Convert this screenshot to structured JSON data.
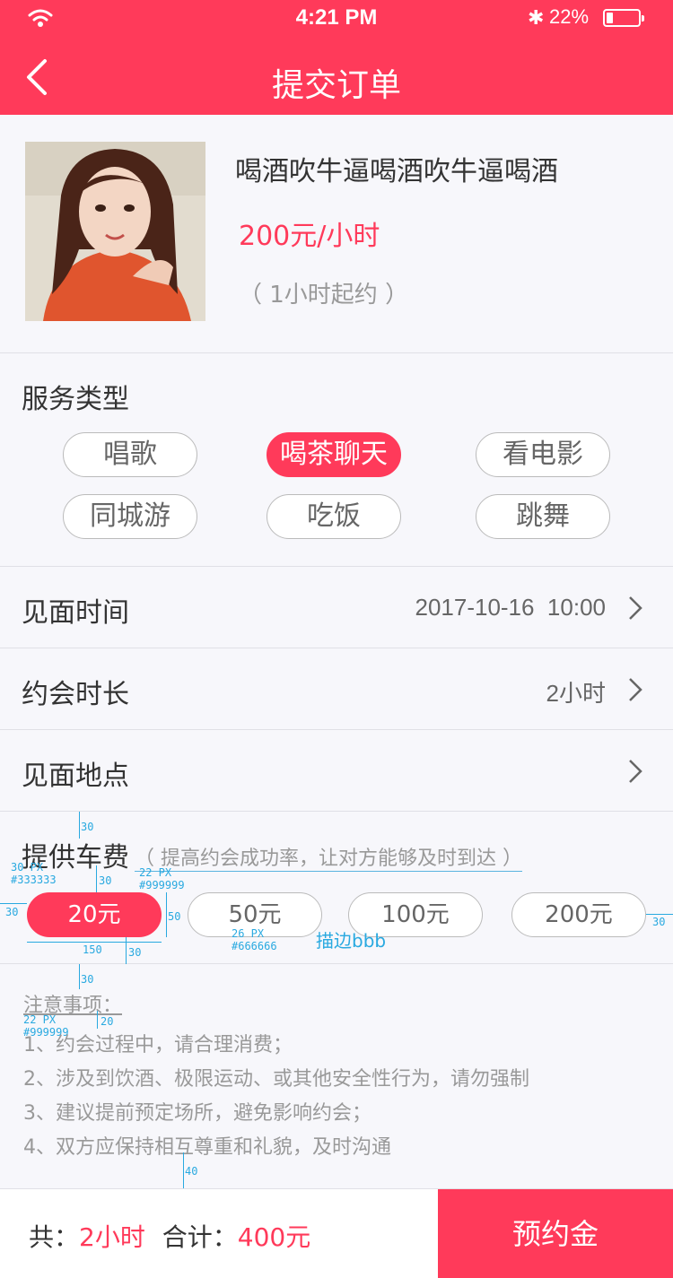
{
  "status_bar": {
    "time": "4:21 PM",
    "battery_percent": "22%",
    "battery_level": 0.22
  },
  "nav": {
    "title": "提交订单"
  },
  "product": {
    "name": "喝酒吹牛逼喝酒吹牛逼喝酒",
    "price": "200元/小时",
    "minimum": "（ 1小时起约 ）"
  },
  "service": {
    "label": "服务类型",
    "options": [
      "唱歌",
      "喝茶聊天",
      "看电影",
      "同城游",
      "吃饭",
      "跳舞"
    ],
    "selected": "喝茶聊天"
  },
  "meeting_time": {
    "label": "见面时间",
    "value": "2017-10-16  10:00"
  },
  "duration": {
    "label": "约会时长",
    "value": "2小时"
  },
  "location": {
    "label": "见面地点",
    "value": ""
  },
  "fee": {
    "label": "提供车费",
    "hint": "（ 提高约会成功率，让对方能够及时到达 ）",
    "options": [
      "20元",
      "50元",
      "100元",
      "200元"
    ],
    "selected": "20元"
  },
  "notes": {
    "title": "注意事项：",
    "items": [
      "1、约会过程中，请合理消费；",
      "2、涉及到饮酒、极限运动、或其他安全性行为，请勿强制",
      "3、建议提前预定场所，避免影响约会；",
      "4、双方应保持相互尊重和礼貌，及时沟通"
    ]
  },
  "annotations": {
    "a30_top": "30",
    "label_size": "30 PX",
    "label_color": "#333333",
    "a30_mid": "30",
    "hint_size": "22 PX",
    "hint_color": "#999999",
    "a30_left": "30",
    "a50": "50",
    "a150": "150",
    "a30_bottom": "30",
    "chip_size": "26 PX",
    "chip_color": "#666666",
    "stroke_note": "描边bbb",
    "a30_right": "30",
    "a30_notes": "30",
    "notes_size": "22 PX",
    "notes_color": "#999999",
    "a20": "20",
    "a40": "40"
  },
  "footer": {
    "total_label": "共：",
    "total_hours": "2小时",
    "sum_label": "合计：",
    "sum_value": "400元",
    "button": "预约金"
  },
  "colors": {
    "accent": "#ff3a5a",
    "annotation": "#29a9e0"
  },
  "icons": [
    "wifi-icon",
    "bluetooth-icon",
    "battery-icon",
    "back-arrow-icon",
    "chevron-right-icon"
  ]
}
